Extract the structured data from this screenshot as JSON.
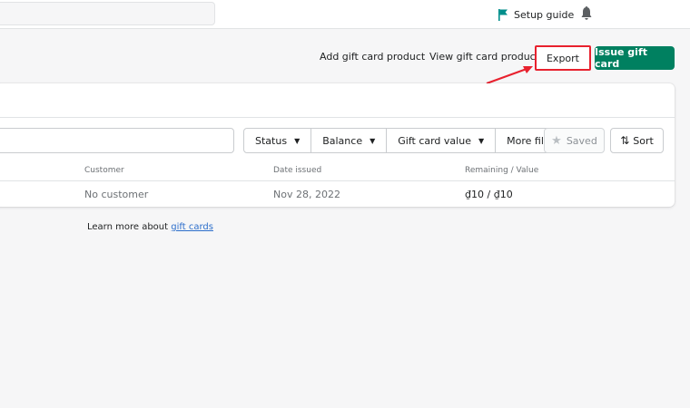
{
  "topbar": {
    "search": {
      "placeholder": ""
    },
    "setup_guide_label": "Setup guide",
    "icons": {
      "flag": "flag-icon",
      "bell": "bell-icon"
    }
  },
  "page_actions": {
    "add_gift_card_product": "Add gift card product",
    "view_gift_card_products": "View gift card products",
    "export": "Export",
    "issue_gift_card": "Issue gift card"
  },
  "filters": {
    "search_placeholder": "",
    "items": [
      {
        "label": "Status",
        "has_caret": true
      },
      {
        "label": "Balance",
        "has_caret": true
      },
      {
        "label": "Gift card value",
        "has_caret": true
      },
      {
        "label": "More filters",
        "has_caret": false
      }
    ],
    "saved_label": "Saved",
    "sort_label": "Sort"
  },
  "table": {
    "headers": [
      "Customer",
      "Date issued",
      "Remaining / Value"
    ],
    "rows": [
      {
        "customer": "No customer",
        "date_issued": "Nov 28, 2022",
        "remaining_value": "₫10 / ₫10"
      }
    ]
  },
  "footer": {
    "prefix": "Learn more about ",
    "link": "gift cards"
  },
  "colors": {
    "primary": "#008060",
    "annotation": "#e8212e",
    "link": "#2c6ecb",
    "flag": "#008e8b"
  }
}
